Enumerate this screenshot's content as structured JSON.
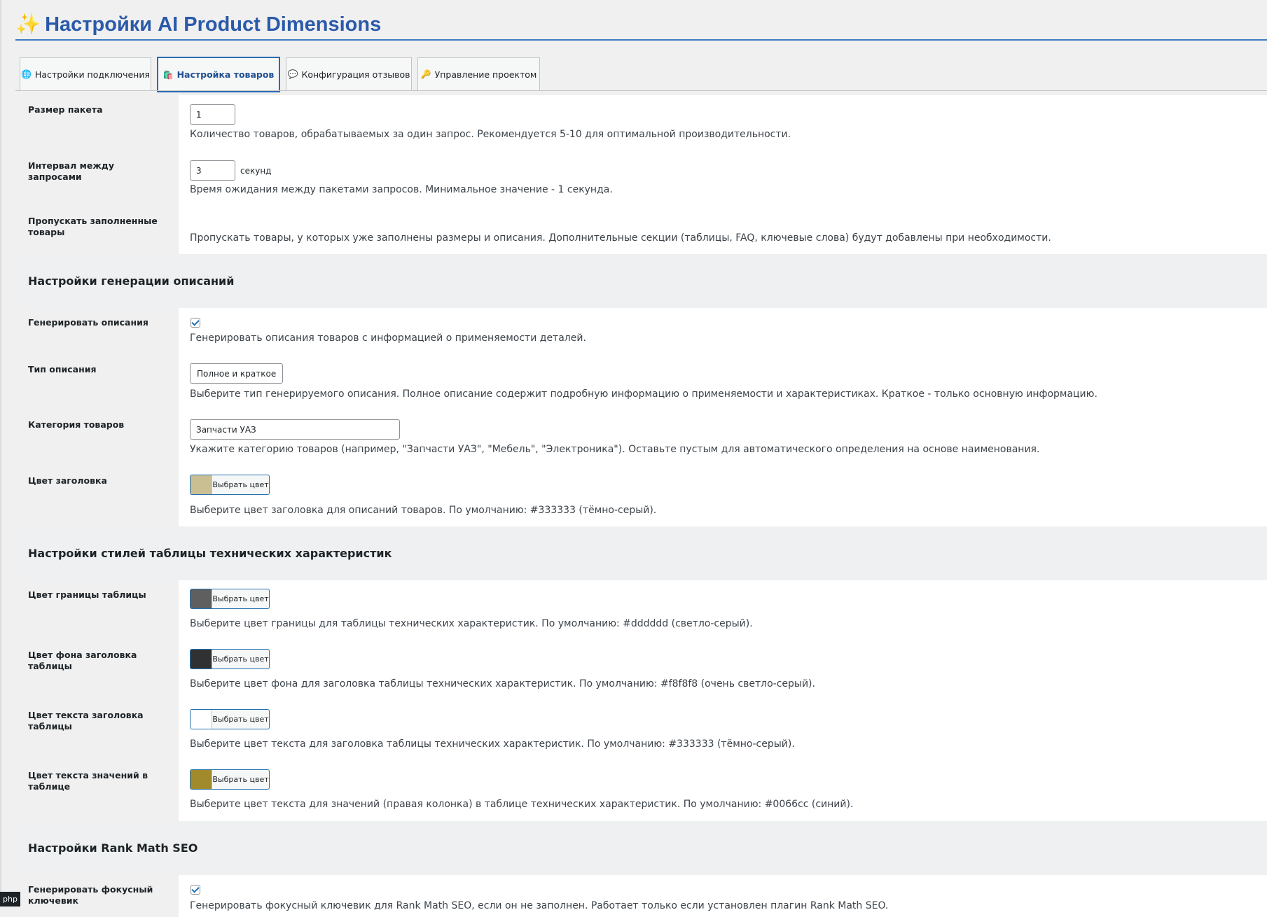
{
  "page": {
    "title": "Настройки AI Product Dimensions",
    "title_icon": "sparkles-icon"
  },
  "tabs": [
    {
      "label": "Настройки подключения",
      "icon": "🌐",
      "active": false
    },
    {
      "label": "Настройка товаров",
      "icon": "🛍️",
      "active": true
    },
    {
      "label": "Конфигурация отзывов",
      "icon": "💬",
      "active": false
    },
    {
      "label": "Управление проектом",
      "icon": "🔑",
      "active": false
    }
  ],
  "batch": {
    "label": "Размер пакета",
    "value": "1",
    "desc": "Количество товаров, обрабатываемых за один запрос. Рекомендуется 5-10 для оптимальной производительности."
  },
  "interval": {
    "label": "Интервал между запросами",
    "value": "3",
    "unit": "секунд",
    "desc": "Время ожидания между пакетами запросов. Минимальное значение - 1 секунда."
  },
  "skip": {
    "label": "Пропускать заполненные товары",
    "checked": true,
    "desc": "Пропускать товары, у которых уже заполнены размеры и описания. Дополнительные секции (таблицы, FAQ, ключевые слова) будут добавлены при необходимости."
  },
  "section_descriptions": {
    "title": "Настройки генерации описаний"
  },
  "gen_desc": {
    "label": "Генерировать описания",
    "checked": true,
    "desc": "Генерировать описания товаров с информацией о применяемости деталей."
  },
  "desc_type": {
    "label": "Тип описания",
    "value": "Полное и краткое",
    "desc": "Выберите тип генерируемого описания. Полное описание содержит подробную информацию о применяемости и характеристиках. Краткое - только основную информацию."
  },
  "category": {
    "label": "Категория товаров",
    "value": "Запчасти УАЗ",
    "desc": "Укажите категорию товаров (например, \"Запчасти УАЗ\", \"Мебель\", \"Электроника\"). Оставьте пустым для автоматического определения на основе наименования."
  },
  "heading_color": {
    "label": "Цвет заголовка",
    "button": "Выбрать цвет",
    "swatch": "#c9bf93",
    "desc": "Выберите цвет заголовка для описаний товаров. По умолчанию: #333333 (тёмно-серый)."
  },
  "section_table": {
    "title": "Настройки стилей таблицы технических характеристик"
  },
  "border_color": {
    "label": "Цвет границы таблицы",
    "button": "Выбрать цвет",
    "swatch": "#5f5f5f",
    "desc": "Выберите цвет границы для таблицы технических характеристик. По умолчанию: #dddddd (светло-серый)."
  },
  "header_bg_color": {
    "label": "Цвет фона заголовка таблицы",
    "button": "Выбрать цвет",
    "swatch": "#2f3133",
    "desc": "Выберите цвет фона для заголовка таблицы технических характеристик. По умолчанию: #f8f8f8 (очень светло-серый)."
  },
  "header_text_color": {
    "label": "Цвет текста заголовка таблицы",
    "button": "Выбрать цвет",
    "swatch": "#ffffff",
    "desc": "Выберите цвет текста для заголовка таблицы технических характеристик. По умолчанию: #333333 (тёмно-серый)."
  },
  "value_text_color": {
    "label": "Цвет текста значений в таблице",
    "button": "Выбрать цвет",
    "swatch": "#a08a2c",
    "desc": "Выберите цвет текста для значений (правая колонка) в таблице технических характеристик. По умолчанию: #0066cc (синий)."
  },
  "section_seo": {
    "title": "Настройки Rank Math SEO"
  },
  "focus_kw": {
    "label": "Генерировать фокусный ключевик",
    "checked": true,
    "desc": "Генерировать фокусный ключевик для Rank Math SEO, если он не заполнен. Работает только если установлен плагин Rank Math SEO."
  },
  "badge": {
    "text": "php"
  }
}
